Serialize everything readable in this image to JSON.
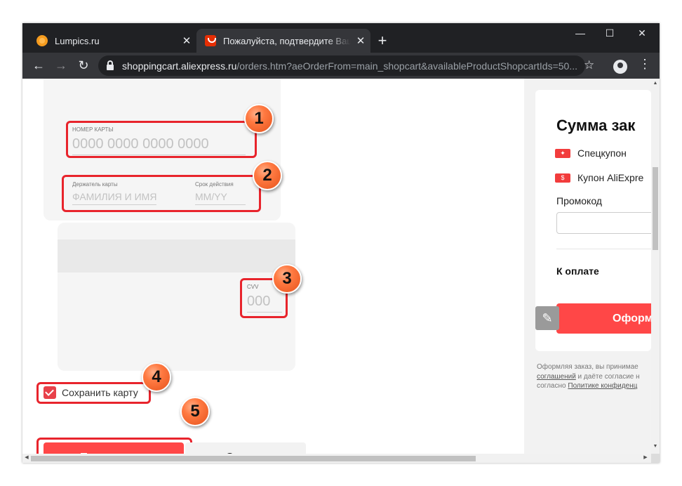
{
  "tabs": [
    {
      "title": "Lumpics.ru",
      "favicon": "lumpics-favicon",
      "active": false
    },
    {
      "title": "Пожалуйста, подтвердите Ваш заказ",
      "favicon": "aliexpress-favicon",
      "active": true
    }
  ],
  "window_controls": {
    "minimize": "—",
    "maximize": "☐",
    "close": "✕"
  },
  "address_bar": {
    "host": "shoppingcart.aliexpress.ru",
    "path": "/orders.htm?aeOrderFrom=main_shopcart&availableProductShopcartIds=50..."
  },
  "card_form": {
    "card_number_label": "НОМЕР КАРТЫ",
    "card_number_placeholder": "0000 0000 0000 0000",
    "holder_label": "Держатель карты",
    "holder_placeholder": "ФАМИЛИЯ И ИМЯ",
    "expiry_label": "Срок действия",
    "expiry_placeholder": "ММ/YY",
    "cvv_label": "CVV",
    "cvv_placeholder": "000"
  },
  "save_card": {
    "label": "Сохранить карту",
    "checked": true
  },
  "buttons": {
    "confirm": "Подтвердить",
    "cancel": "Отмена"
  },
  "callouts": [
    "1",
    "2",
    "3",
    "4",
    "5"
  ],
  "summary": {
    "title": "Сумма зак",
    "coupons": [
      "Спецкупон",
      "Купон AliExpre"
    ],
    "promo_label": "Промокод",
    "pay_label": "К оплате",
    "order_button": "Оформ"
  },
  "terms": {
    "line1": "Оформляя заказ, вы принимае",
    "line2_link": "соглашений",
    "line2_text": " и даёте согласие н",
    "line3_text": "согласно ",
    "line3_link": "Политике конфиденц"
  },
  "colors": {
    "accent": "#ff4747",
    "highlight": "#e8242c",
    "badge": "#ff7a42",
    "chrome_dark": "#202124",
    "chrome_toolbar": "#35363a"
  }
}
